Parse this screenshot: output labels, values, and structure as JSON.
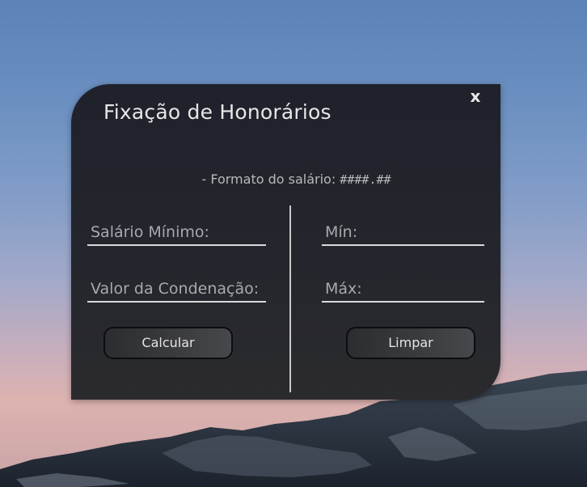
{
  "dialog": {
    "title": "Fixação de Honorários",
    "close_glyph": "x",
    "hint_prefix": "- Formato do salário: ",
    "hint_format": "####.##"
  },
  "left_fields": {
    "salario_placeholder": "Salário Mínimo:",
    "condenacao_placeholder": "Valor da Condenação:"
  },
  "right_fields": {
    "min_placeholder": "Mín:",
    "max_placeholder": "Máx:"
  },
  "buttons": {
    "calcular_label": "Calcular",
    "limpar_label": "Limpar"
  },
  "colors": {
    "dialog_bg": "#24262d",
    "text": "#e6e6e6",
    "placeholder": "#a9a9ad",
    "underline": "#d9d9d9"
  }
}
